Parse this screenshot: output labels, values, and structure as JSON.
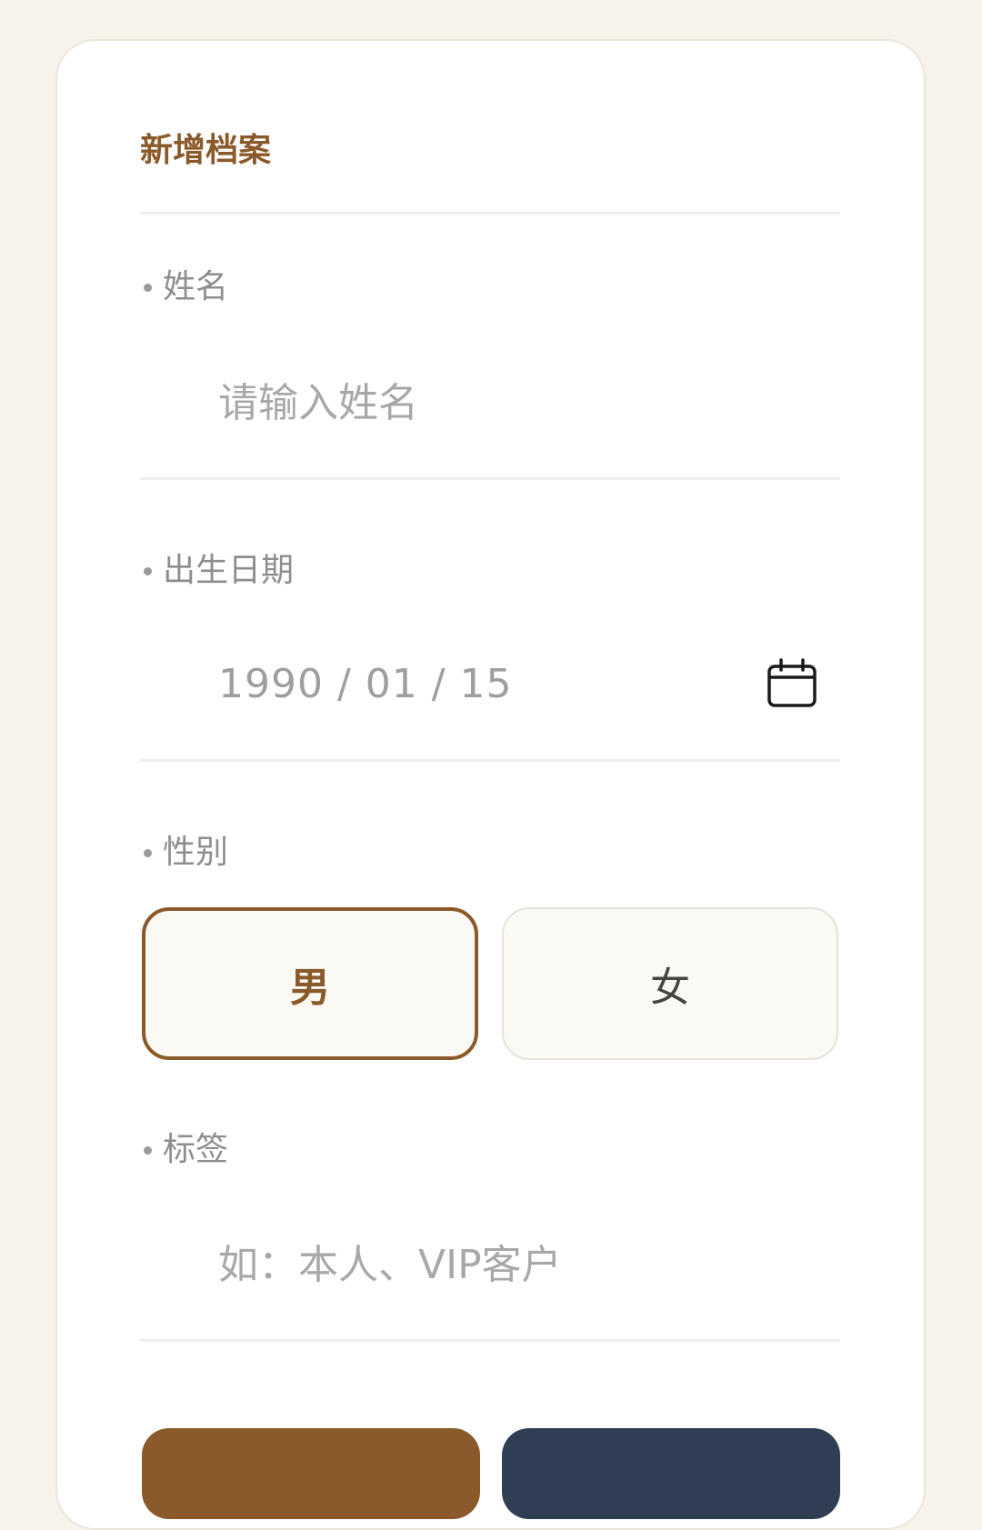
{
  "form": {
    "title": "新增档案",
    "name": {
      "label": "姓名",
      "placeholder": "请输入姓名",
      "value": ""
    },
    "birthdate": {
      "label": "出生日期",
      "value": "1990 / 01 / 15",
      "icon": "calendar-icon"
    },
    "gender": {
      "label": "性别",
      "options": [
        "男",
        "女"
      ],
      "selected": "男"
    },
    "tags": {
      "label": "标签",
      "placeholder": "如：本人、VIP客户",
      "value": ""
    }
  },
  "colors": {
    "accent": "#8b5a2b",
    "secondary_button": "#2f3e52",
    "background": "#f7f3ea"
  }
}
